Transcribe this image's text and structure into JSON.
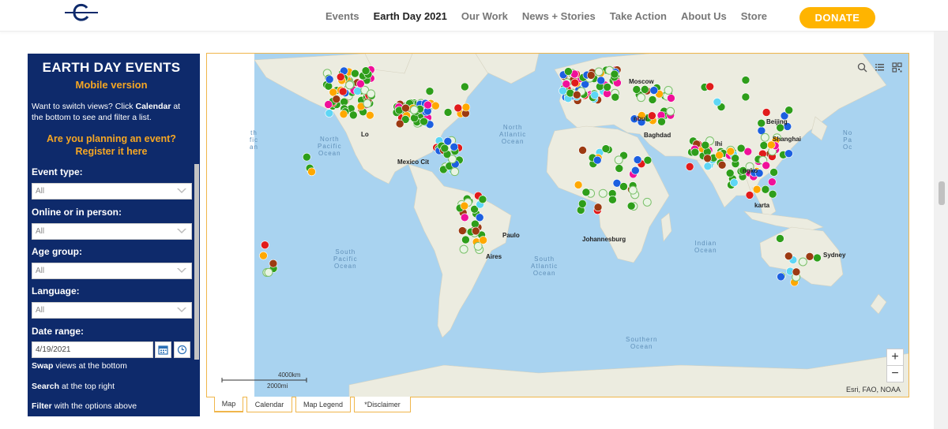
{
  "nav": {
    "items": [
      "Events",
      "Earth Day 2021",
      "Our Work",
      "News + Stories",
      "Take Action",
      "About Us",
      "Store"
    ],
    "active_index": 1,
    "donate_label": "DONATE"
  },
  "panel": {
    "title": "EARTH DAY EVENTS",
    "subtitle": "Mobile version",
    "intro_a": "Want to switch views? Click ",
    "intro_b": "Calendar",
    "intro_c": " at the bottom to see and filter a list.",
    "cta_line1": "Are you planning an event?",
    "cta_line2": "Register it here",
    "filters": [
      {
        "label": "Event type:",
        "value": "All"
      },
      {
        "label": "Online or in person:",
        "value": "All"
      },
      {
        "label": "Age group:",
        "value": "All"
      },
      {
        "label": "Language:",
        "value": "All"
      }
    ],
    "date_label": "Date range:",
    "date_value": "4/19/2021",
    "foot1_b": "Swap",
    "foot1_r": " views at the bottom",
    "foot2_b": "Search",
    "foot2_r": " at the top right",
    "foot3_b": "Filter",
    "foot3_r": " with the options above"
  },
  "map": {
    "labels": {
      "north_pacific": "North\nPacific\nOcean",
      "north_atlantic": "North\nAtlantic\nOcean",
      "south_pacific": "South\nPacific\nOcean",
      "south_atlantic": "South\nAtlantic\nOcean",
      "indian": "Indian\nOcean",
      "southern": "Southern\nOcean",
      "east_pacific": "No\nPa\nOc",
      "west_pacific": "th\nfic\nan"
    },
    "cities": {
      "moscow": "Moscow",
      "beijing": "Beijing",
      "shanghai": "Shanghai",
      "baghdad": "Baghdad",
      "johannesburg": "Johannesburg",
      "sydney": "Sydney",
      "paulo": "Paulo",
      "aires": "Aires",
      "mexico": "Mexico Cit",
      "istanbul": "nbul",
      "delhi": "lhi",
      "bangkok": "ngko",
      "jakarta": "karta",
      "los": "Lo"
    },
    "scale_km": "4000km",
    "scale_mi": "2000mi",
    "attribution": "Esri, FAO, NOAA",
    "zoom_in": "+",
    "zoom_out": "−"
  },
  "tabs": [
    "Map",
    "Calendar",
    "Map Legend",
    "*Disclaimer"
  ],
  "colors": {
    "panel_bg": "#0e2a6b",
    "accent": "#f5a623",
    "donate": "#ffb400",
    "ocean": "#a9d3f0",
    "land": "#ecece0",
    "green_marker": "#2e9e1a",
    "orange_marker": "#ffa800",
    "magenta_marker": "#f0109a",
    "red_marker": "#e11b1b",
    "blue_marker": "#1c5fe0",
    "cyan_marker": "#5ed6f5",
    "brown_marker": "#9c3a12"
  }
}
